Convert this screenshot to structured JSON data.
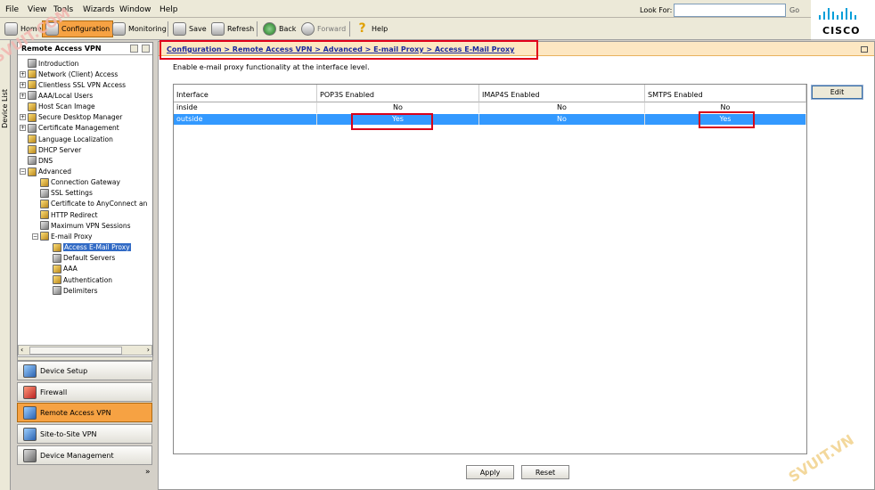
{
  "menu": [
    "File",
    "View",
    "Tools",
    "Wizards",
    "Window",
    "Help"
  ],
  "toolbar": {
    "home": "Home",
    "configuration": "Configuration",
    "monitoring": "Monitoring",
    "save": "Save",
    "refresh": "Refresh",
    "back": "Back",
    "forward": "Forward",
    "help": "Help",
    "lookfor_label": "Look For:",
    "lookfor_value": "",
    "go": "Go"
  },
  "brand": {
    "logo_text": "CISCO",
    "accent": "#049fd9"
  },
  "device_list_tab": "Device List",
  "nav": {
    "title": "Remote Access VPN",
    "tree": [
      {
        "label": "Introduction"
      },
      {
        "label": "Network (Client) Access"
      },
      {
        "label": "Clientless SSL VPN Access"
      },
      {
        "label": "AAA/Local Users"
      },
      {
        "label": "Host Scan Image"
      },
      {
        "label": "Secure Desktop Manager"
      },
      {
        "label": "Certificate Management"
      },
      {
        "label": "Language Localization"
      },
      {
        "label": "DHCP Server"
      },
      {
        "label": "DNS"
      },
      {
        "label": "Advanced"
      },
      {
        "label": "Connection Gateway"
      },
      {
        "label": "SSL Settings"
      },
      {
        "label": "Certificate to AnyConnect an"
      },
      {
        "label": "HTTP Redirect"
      },
      {
        "label": "Maximum VPN Sessions"
      },
      {
        "label": "E-mail Proxy"
      },
      {
        "label": "Access E-Mail Proxy"
      },
      {
        "label": "Default Servers"
      },
      {
        "label": "AAA"
      },
      {
        "label": "Authentication"
      },
      {
        "label": "Delimiters"
      }
    ],
    "buttons": [
      "Device Setup",
      "Firewall",
      "Remote Access VPN",
      "Site-to-Site VPN",
      "Device Management"
    ]
  },
  "breadcrumb": "Configuration > Remote Access VPN > Advanced > E-mail Proxy > Access E-Mail Proxy",
  "description": "Enable e-mail proxy functionality at the interface level.",
  "table": {
    "headers": [
      "Interface",
      "POP3S Enabled",
      "IMAP4S Enabled",
      "SMTPS Enabled"
    ],
    "rows": [
      [
        "inside",
        "No",
        "No",
        "No"
      ],
      [
        "outside",
        "Yes",
        "No",
        "Yes"
      ]
    ],
    "selected_row": 1,
    "selection_color": "#3399ff"
  },
  "buttons": {
    "edit": "Edit",
    "apply": "Apply",
    "reset": "Reset"
  },
  "watermarks": [
    "SVUIT.COM",
    "SVUIT.VN"
  ],
  "highlight_color": "#e2001a"
}
